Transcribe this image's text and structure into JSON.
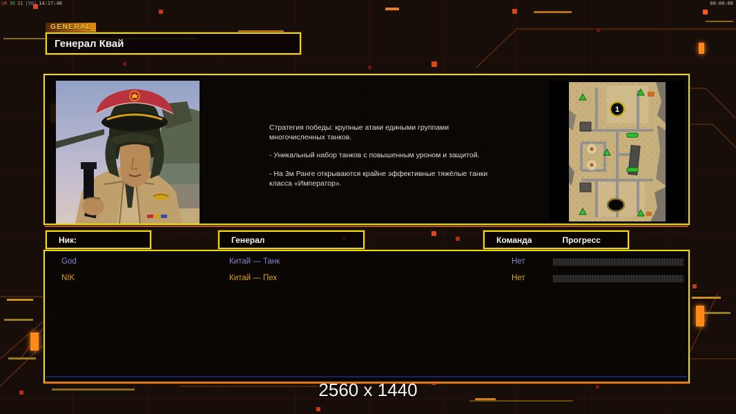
{
  "overlay": {
    "segments": [
      {
        "text": "UR",
        "color": "#c05050"
      },
      {
        "text": "30",
        "color": "#50b050"
      },
      {
        "text": "31",
        "color": "#d0b030"
      },
      {
        "text": "|50|",
        "color": "#8090a8"
      },
      {
        "text": "14:17:40",
        "color": "#d0c0a0"
      }
    ],
    "clock": "00:00:00"
  },
  "header": {
    "tab_label": "GENERAL",
    "title": "Генерал Квай"
  },
  "briefing": {
    "paragraphs": [
      "Стратегия победы: крупные атаки едиными группами многочисленных танков.",
      "- Уникальный набор танков с повышенным уроном и защитой.",
      "- На 3м Ранге открываются крайне эффективные тяжёлые танки класса «Император»."
    ]
  },
  "minimap": {
    "marker_label": "1"
  },
  "table": {
    "headers": {
      "nick": "Ник:",
      "general": "Генерал",
      "team": "Команда",
      "progress": "Прогресс"
    },
    "rows": [
      {
        "nick": "God",
        "general": "Китай — Танк",
        "team": "Нет",
        "color": "#8787d9",
        "progress_percent": 0
      },
      {
        "nick": "NIK",
        "general": "Китай — Пех",
        "team": "Нет",
        "color": "#d9a21b",
        "progress_percent": 0
      }
    ]
  },
  "footer": {
    "resolution": "2560 x 1440"
  },
  "colors": {
    "border_yellow": "#e8df12",
    "border_orange": "#e07818",
    "accent_glow": "#ff8a1c",
    "background": "#170d09"
  }
}
